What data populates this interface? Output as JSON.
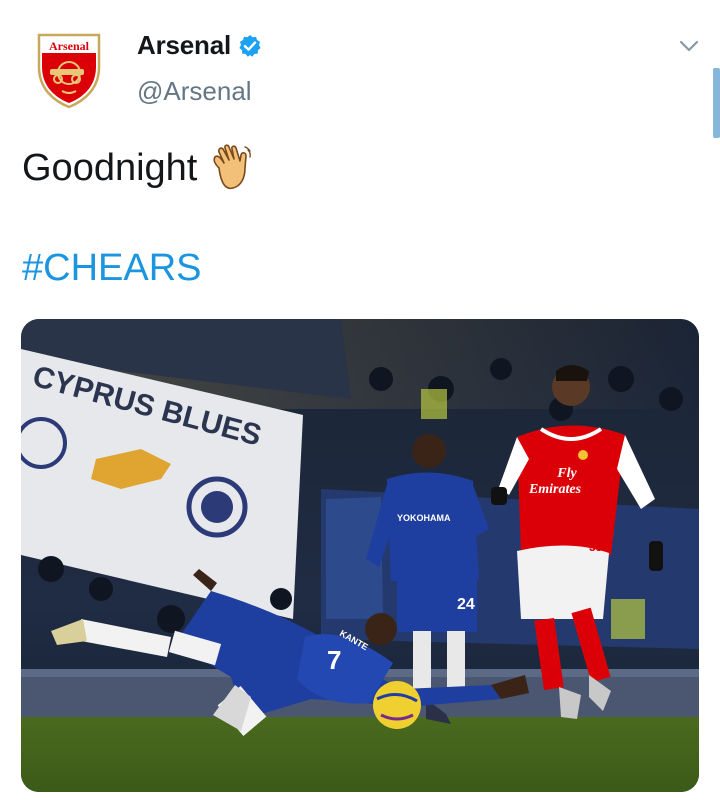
{
  "tweet": {
    "display_name": "Arsenal",
    "handle": "@Arsenal",
    "text": "Goodnight",
    "emoji": "waving-hand-icon",
    "hashtag": "#CHEARS",
    "avatar_text": "Arsenal",
    "verified": "verified-badge-icon"
  },
  "media": {
    "banner_text": "CYPRUS BLUES",
    "shirt_text_main": "Fly",
    "shirt_text_sub": "Emirates",
    "player_name": "KANTE",
    "player_number": "7",
    "sponsor_text": "YOKOHAMA",
    "number_small": "35",
    "number_back": "24"
  },
  "colors": {
    "link": "#1b95e0",
    "handle": "#657786",
    "arsenal_red": "#db0007",
    "chelsea_blue": "#1f3fa0",
    "chevron": "#8899a6"
  }
}
